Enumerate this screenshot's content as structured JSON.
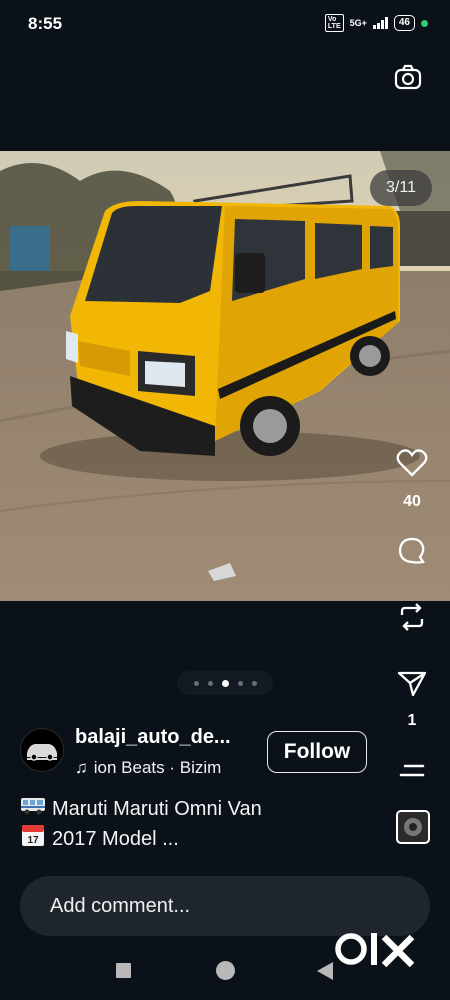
{
  "status_bar": {
    "time": "8:55",
    "network_badge": "VoLTE",
    "network": "5G+",
    "battery": "46"
  },
  "post": {
    "image_counter": "3/11",
    "likes": "40",
    "shares": "1",
    "username": "balaji_auto_de...",
    "music": "ion Beats · Bizim",
    "follow_label": "Follow",
    "caption_line1": "Maruti Maruti Omni Van",
    "caption_line2": "2017 Model ...",
    "comment_placeholder": "Add comment...",
    "carousel_total": 5,
    "carousel_active": 2
  },
  "watermark": "olx",
  "colors": {
    "background": "#0b1118",
    "van": "#f2b705",
    "status_dot": "#2ecc71"
  },
  "icons": [
    "camera-icon",
    "heart-icon",
    "comment-icon",
    "repost-icon",
    "send-icon",
    "menu-icon",
    "music-note-icon",
    "van-emoji-icon",
    "calendar-emoji-icon"
  ]
}
